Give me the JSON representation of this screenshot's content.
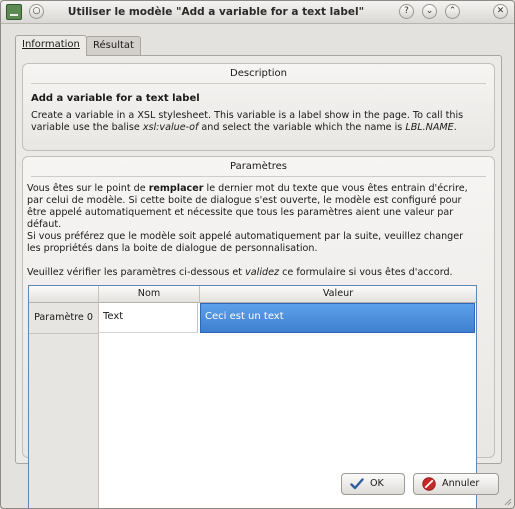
{
  "window": {
    "title": "Utiliser le modèle \"Add a variable for a text label\"",
    "help_glyph": "?",
    "minimize_glyph": "⌄",
    "maximize_glyph": "⌃",
    "close_glyph": "✕"
  },
  "tabs": [
    {
      "label": "Information",
      "active": true
    },
    {
      "label": "Résultat",
      "active": false
    }
  ],
  "description": {
    "title": "Description",
    "heading": "Add a variable for a text label",
    "text_1": "Create a variable in a XSL stylesheet. This variable is a label show in the page. To call this variable use the balise ",
    "text_em1": "xsl:value-of",
    "text_2": " and select the variable which the name is ",
    "text_em2": "LBL.NAME",
    "text_3": "."
  },
  "parameters": {
    "title": "Paramètres",
    "p1_a": "Vous êtes sur le point de ",
    "p1_bold": "remplacer",
    "p1_b": " le dernier mot du texte que vous êtes entrain d'écrire, par celui de modèle. Si cette boite de dialogue s'est ouverte, le modèle est configuré pour être appelé automatiquement et nécessite que tous les paramètres aient une valeur par défaut.",
    "p2": "Si vous préférez que le modèle soit appelé automatiquement par la suite, veuillez changer les propriétés dans la boite de dialogue de personnalisation.",
    "p3_a": "Veuillez vérifier les paramètres ci-dessous et ",
    "p3_em": "validez",
    "p3_b": " ce formulaire si vous êtes d'accord.",
    "table": {
      "col_nom": "Nom",
      "col_valeur": "Valeur",
      "rows": [
        {
          "header": "Paramètre 0",
          "nom": "Text",
          "valeur": "Ceci est un text"
        }
      ]
    }
  },
  "buttons": {
    "ok": "OK",
    "cancel": "Annuler"
  },
  "colors": {
    "selection": "#3f7fd0",
    "ok_icon": "#2f5f9e",
    "cancel_icon": "#c62828"
  }
}
